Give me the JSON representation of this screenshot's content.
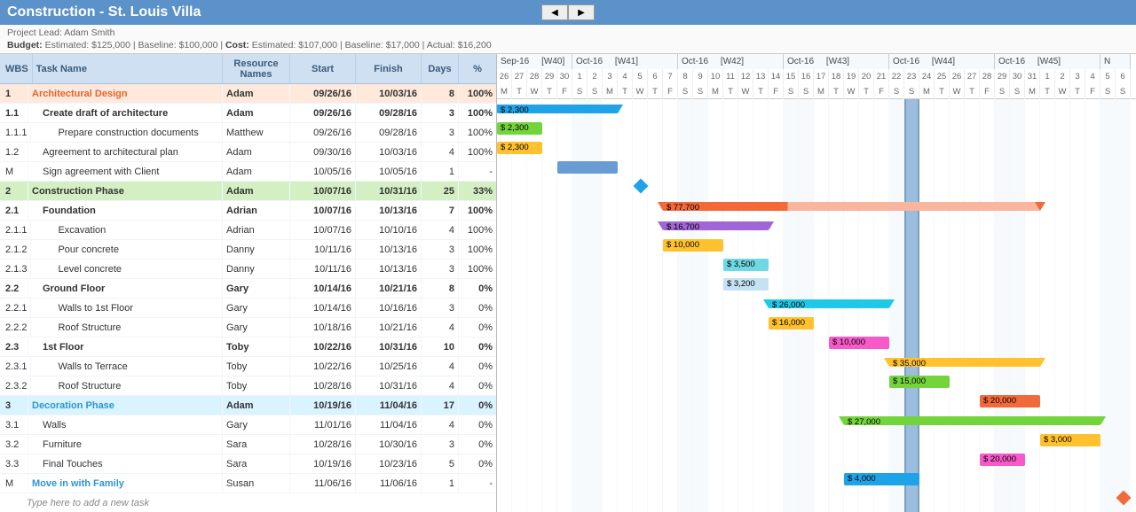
{
  "title": "Construction - St. Louis Villa",
  "lead_label": "Project Lead:",
  "lead_name": "Adam Smith",
  "budget_line": {
    "budget_l": "Budget:",
    "b_est_l": "Estimated:",
    "b_est": "$125,000",
    "b_base_l": "Baseline:",
    "b_base": "$100,000",
    "cost_l": "Cost:",
    "c_est_l": "Estimated:",
    "c_est": "$107,000",
    "c_base_l": "Baseline:",
    "c_base": "$17,000",
    "c_act_l": "Actual:",
    "c_act": "$16,200"
  },
  "cols": {
    "wbs": "WBS",
    "task": "Task Name",
    "res": "Resource Names",
    "start": "Start",
    "finish": "Finish",
    "days": "Days",
    "pct": "%"
  },
  "newtask_placeholder": "Type here to add a new task",
  "timeline": {
    "start": "2016-09-26",
    "today_index": 27,
    "weeks": [
      {
        "label": "Sep-16",
        "wk": "[W40]",
        "days": 5
      },
      {
        "label": "Oct-16",
        "wk": "[W41]",
        "days": 7
      },
      {
        "label": "Oct-16",
        "wk": "[W42]",
        "days": 7
      },
      {
        "label": "Oct-16",
        "wk": "[W43]",
        "days": 7
      },
      {
        "label": "Oct-16",
        "wk": "[W44]",
        "days": 7
      },
      {
        "label": "Oct-16",
        "wk": "[W45]",
        "days": 7
      },
      {
        "label": "N",
        "wk": "",
        "days": 2
      }
    ],
    "daynums": [
      "26",
      "27",
      "28",
      "29",
      "30",
      "1",
      "2",
      "3",
      "4",
      "5",
      "6",
      "7",
      "8",
      "9",
      "10",
      "11",
      "12",
      "13",
      "14",
      "15",
      "16",
      "17",
      "18",
      "19",
      "20",
      "21",
      "22",
      "23",
      "24",
      "25",
      "26",
      "27",
      "28",
      "29",
      "30",
      "31",
      "1",
      "2",
      "3",
      "4",
      "5",
      "6"
    ],
    "dow": [
      "M",
      "T",
      "W",
      "T",
      "F",
      "S",
      "S",
      "M",
      "T",
      "W",
      "T",
      "F",
      "S",
      "S",
      "M",
      "T",
      "W",
      "T",
      "F",
      "S",
      "S",
      "M",
      "T",
      "W",
      "T",
      "F",
      "S",
      "S",
      "M",
      "T",
      "W",
      "T",
      "F",
      "S",
      "S",
      "M",
      "T",
      "W",
      "T",
      "F",
      "S",
      "S"
    ]
  },
  "tasks": [
    {
      "wbs": "1",
      "name": "Architectural Design",
      "res": "Adam",
      "start": "09/26/16",
      "finish": "10/03/16",
      "days": "8",
      "pct": "100%",
      "cls": "group ph1",
      "ind": 0,
      "bar": {
        "s": 0,
        "d": 8,
        "type": "summary",
        "color": "#1ea3e8",
        "label": "$ 2,300"
      }
    },
    {
      "wbs": "1.1",
      "name": "Create draft of architecture",
      "res": "Adam",
      "start": "09/26/16",
      "finish": "09/28/16",
      "days": "3",
      "pct": "100%",
      "cls": "subgroup",
      "ind": 1,
      "bar": {
        "s": 0,
        "d": 3,
        "type": "task",
        "color": "#74d43b",
        "label": "$ 2,300"
      }
    },
    {
      "wbs": "1.1.1",
      "name": "Prepare construction documents",
      "res": "Matthew",
      "start": "09/26/16",
      "finish": "09/28/16",
      "days": "3",
      "pct": "100%",
      "cls": "",
      "ind": 2,
      "bar": {
        "s": 0,
        "d": 3,
        "type": "task",
        "color": "#ffc22e",
        "label": "$ 2,300"
      }
    },
    {
      "wbs": "1.2",
      "name": "Agreement to architectural plan",
      "res": "Adam",
      "start": "09/30/16",
      "finish": "10/03/16",
      "days": "4",
      "pct": "100%",
      "cls": "",
      "ind": 1,
      "bar": {
        "s": 4,
        "d": 4,
        "type": "task",
        "color": "#6a9cd4",
        "label": ""
      }
    },
    {
      "wbs": "M",
      "name": "Sign agreement with Client",
      "res": "Adam",
      "start": "10/05/16",
      "finish": "10/05/16",
      "days": "1",
      "pct": "-",
      "cls": "",
      "ind": 1,
      "bar": {
        "s": 9,
        "d": 0,
        "type": "diamond",
        "color": "#1ea3e8",
        "label": ""
      }
    },
    {
      "wbs": "2",
      "name": "Construction Phase",
      "res": "Adam",
      "start": "10/07/16",
      "finish": "10/31/16",
      "days": "25",
      "pct": "33%",
      "cls": "group ph2",
      "ind": 0,
      "bar": {
        "s": 11,
        "d": 25,
        "type": "summary",
        "color": "#f26a3a",
        "fade": "#f9b59e",
        "label": "$ 77,700"
      }
    },
    {
      "wbs": "2.1",
      "name": "Foundation",
      "res": "Adrian",
      "start": "10/07/16",
      "finish": "10/13/16",
      "days": "7",
      "pct": "100%",
      "cls": "subgroup",
      "ind": 1,
      "bar": {
        "s": 11,
        "d": 7,
        "type": "summary",
        "color": "#a065d6",
        "label": "$ 16,700"
      }
    },
    {
      "wbs": "2.1.1",
      "name": "Excavation",
      "res": "Adrian",
      "start": "10/07/16",
      "finish": "10/10/16",
      "days": "4",
      "pct": "100%",
      "cls": "",
      "ind": 2,
      "bar": {
        "s": 11,
        "d": 4,
        "type": "task",
        "color": "#ffc22e",
        "label": "$ 10,000"
      }
    },
    {
      "wbs": "2.1.2",
      "name": "Pour concrete",
      "res": "Danny",
      "start": "10/11/16",
      "finish": "10/13/16",
      "days": "3",
      "pct": "100%",
      "cls": "",
      "ind": 2,
      "bar": {
        "s": 15,
        "d": 3,
        "type": "task",
        "color": "#6fd9e3",
        "label": "$ 3,500"
      }
    },
    {
      "wbs": "2.1.3",
      "name": "Level concrete",
      "res": "Danny",
      "start": "10/11/16",
      "finish": "10/13/16",
      "days": "3",
      "pct": "100%",
      "cls": "",
      "ind": 2,
      "bar": {
        "s": 15,
        "d": 3,
        "type": "task",
        "color": "#c5e2f5",
        "label": "$ 3,200"
      }
    },
    {
      "wbs": "2.2",
      "name": "Ground Floor",
      "res": "Gary",
      "start": "10/14/16",
      "finish": "10/21/16",
      "days": "8",
      "pct": "0%",
      "cls": "subgroup",
      "ind": 1,
      "bar": {
        "s": 18,
        "d": 8,
        "type": "summary",
        "color": "#1ec9e8",
        "label": "$ 26,000"
      }
    },
    {
      "wbs": "2.2.1",
      "name": "Walls to 1st Floor",
      "res": "Gary",
      "start": "10/14/16",
      "finish": "10/16/16",
      "days": "3",
      "pct": "0%",
      "cls": "",
      "ind": 2,
      "bar": {
        "s": 18,
        "d": 3,
        "type": "task",
        "color": "#ffc22e",
        "label": "$ 16,000"
      }
    },
    {
      "wbs": "2.2.2",
      "name": "Roof Structure",
      "res": "Gary",
      "start": "10/18/16",
      "finish": "10/21/16",
      "days": "4",
      "pct": "0%",
      "cls": "",
      "ind": 2,
      "bar": {
        "s": 22,
        "d": 4,
        "type": "task",
        "color": "#f759c9",
        "label": "$ 10,000"
      }
    },
    {
      "wbs": "2.3",
      "name": "1st Floor",
      "res": "Toby",
      "start": "10/22/16",
      "finish": "10/31/16",
      "days": "10",
      "pct": "0%",
      "cls": "subgroup",
      "ind": 1,
      "bar": {
        "s": 26,
        "d": 10,
        "type": "summary",
        "color": "#ffc22e",
        "label": "$ 35,000"
      }
    },
    {
      "wbs": "2.3.1",
      "name": "Walls to Terrace",
      "res": "Toby",
      "start": "10/22/16",
      "finish": "10/25/16",
      "days": "4",
      "pct": "0%",
      "cls": "",
      "ind": 2,
      "bar": {
        "s": 26,
        "d": 4,
        "type": "task",
        "color": "#74d43b",
        "label": "$ 15,000"
      }
    },
    {
      "wbs": "2.3.2",
      "name": "Roof Structure",
      "res": "Toby",
      "start": "10/28/16",
      "finish": "10/31/16",
      "days": "4",
      "pct": "0%",
      "cls": "",
      "ind": 2,
      "bar": {
        "s": 32,
        "d": 4,
        "type": "task",
        "color": "#f26a3a",
        "label": "$ 20,000"
      }
    },
    {
      "wbs": "3",
      "name": "Decoration Phase",
      "res": "Adam",
      "start": "10/19/16",
      "finish": "11/04/16",
      "days": "17",
      "pct": "0%",
      "cls": "group ph3",
      "ind": 0,
      "bar": {
        "s": 23,
        "d": 17,
        "type": "summary",
        "color": "#74d43b",
        "label": "$ 27,000"
      }
    },
    {
      "wbs": "3.1",
      "name": "Walls",
      "res": "Gary",
      "start": "11/01/16",
      "finish": "11/04/16",
      "days": "4",
      "pct": "0%",
      "cls": "",
      "ind": 1,
      "bar": {
        "s": 36,
        "d": 4,
        "type": "task",
        "color": "#ffc22e",
        "label": "$ 3,000"
      }
    },
    {
      "wbs": "3.2",
      "name": "Furniture",
      "res": "Sara",
      "start": "10/28/16",
      "finish": "10/30/16",
      "days": "3",
      "pct": "0%",
      "cls": "",
      "ind": 1,
      "bar": {
        "s": 32,
        "d": 3,
        "type": "task",
        "color": "#f759c9",
        "label": "$ 20,000"
      }
    },
    {
      "wbs": "3.3",
      "name": "Final Touches",
      "res": "Sara",
      "start": "10/19/16",
      "finish": "10/23/16",
      "days": "5",
      "pct": "0%",
      "cls": "",
      "ind": 1,
      "bar": {
        "s": 23,
        "d": 5,
        "type": "task",
        "color": "#1ea3e8",
        "label": "$ 4,000"
      }
    },
    {
      "wbs": "M",
      "name": "Move in with Family",
      "res": "Susan",
      "start": "11/06/16",
      "finish": "11/06/16",
      "days": "1",
      "pct": "-",
      "cls": "milestone-row",
      "ind": 0,
      "bar": {
        "s": 41,
        "d": 0,
        "type": "diamond",
        "color": "#f26a3a",
        "label": ""
      }
    }
  ]
}
